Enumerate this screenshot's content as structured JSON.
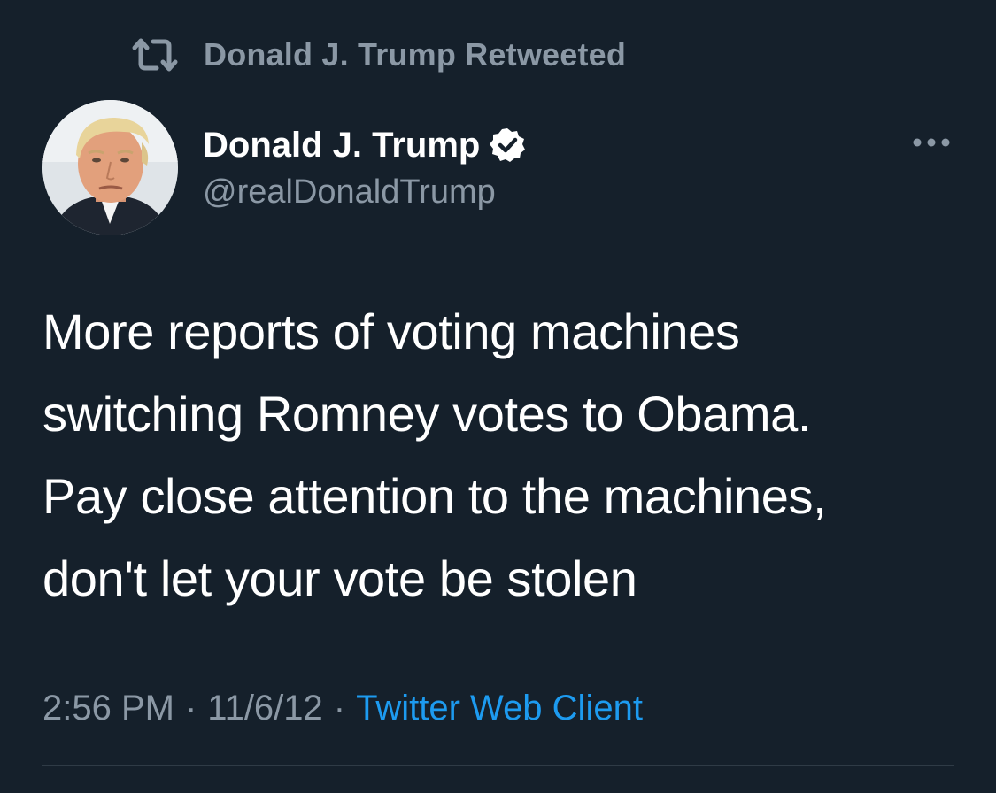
{
  "retweet": {
    "icon": "retweet-icon",
    "text": "Donald J. Trump Retweeted"
  },
  "author": {
    "avatar_icon": "avatar-photo",
    "display_name": "Donald J. Trump",
    "verified_icon": "verified-badge-icon",
    "handle": "@realDonaldTrump"
  },
  "menu": {
    "icon": "more-options-icon"
  },
  "tweet": {
    "lines": [
      "More reports of voting machines",
      "switching Romney votes to Obama.",
      "Pay close attention to the machines,",
      "don't let your vote be stolen"
    ]
  },
  "meta": {
    "time": "2:56 PM",
    "separator": "·",
    "date": "11/6/12",
    "source": "Twitter Web Client"
  },
  "colors": {
    "background": "#15202b",
    "primary_text": "#ffffff",
    "secondary_text": "#8b98a5",
    "link": "#1d9bf0",
    "divider": "#2f3b46"
  }
}
